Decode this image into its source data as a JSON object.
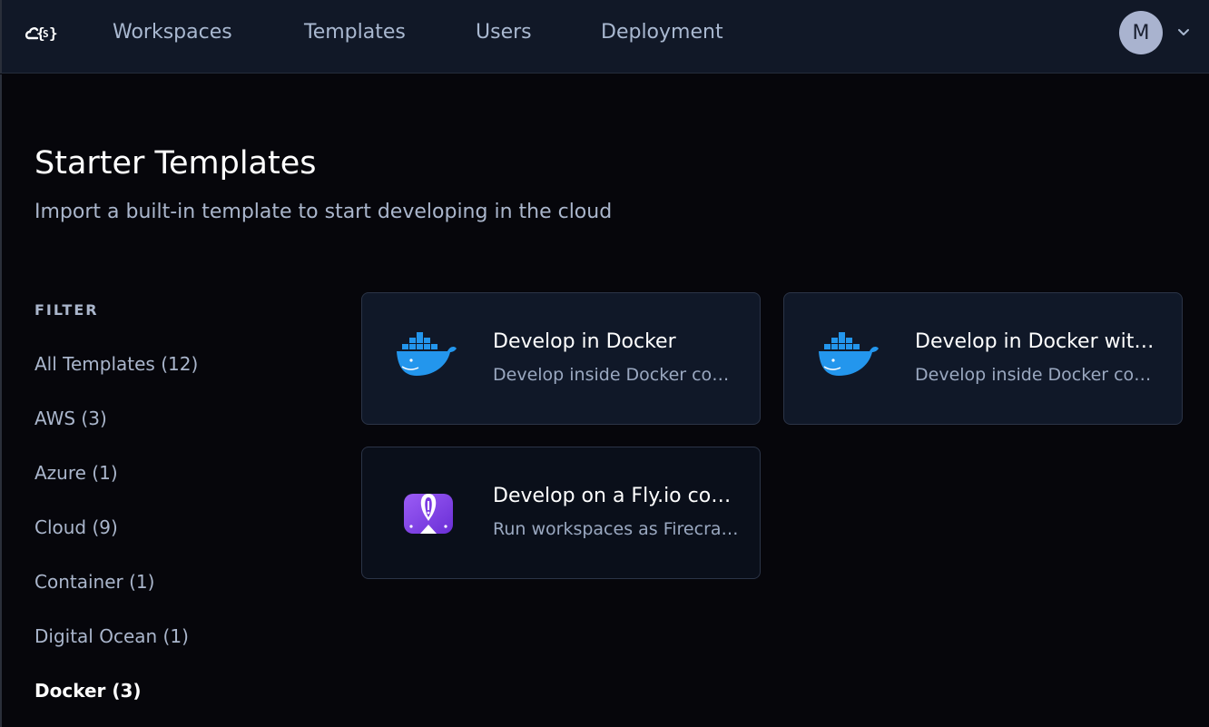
{
  "nav": {
    "logo": "coder-logo",
    "items": [
      {
        "label": "Workspaces"
      },
      {
        "label": "Templates"
      },
      {
        "label": "Users"
      },
      {
        "label": "Deployment"
      }
    ],
    "avatar_initial": "M"
  },
  "page": {
    "title": "Starter Templates",
    "subtitle": "Import a built-in template to start developing in the cloud"
  },
  "filter": {
    "heading": "FILTER",
    "items": [
      {
        "label": "All Templates (12)"
      },
      {
        "label": "AWS (3)"
      },
      {
        "label": "Azure (1)"
      },
      {
        "label": "Cloud (9)"
      },
      {
        "label": "Container (1)"
      },
      {
        "label": "Digital Ocean (1)"
      },
      {
        "label": "Docker (3)",
        "selected": true
      }
    ]
  },
  "templates": [
    {
      "title": "Develop in Docker",
      "description": "Develop inside Docker containers using your local daemon",
      "icon": "docker-icon"
    },
    {
      "title": "Develop in Docker with a dotfiles URL",
      "description": "Develop inside Docker containers using your local daemon",
      "icon": "docker-icon"
    },
    {
      "title": "Develop on a Fly.io container",
      "description": "Run workspaces as Firecracker VMs on Fly.io",
      "icon": "flyio-icon"
    }
  ],
  "colors": {
    "background": "#06060b",
    "topbar": "#111827",
    "card": "#101828",
    "docker_blue": "#2396ed",
    "flyio_purple": "#7b3be2",
    "muted_text": "#aab6cc"
  }
}
